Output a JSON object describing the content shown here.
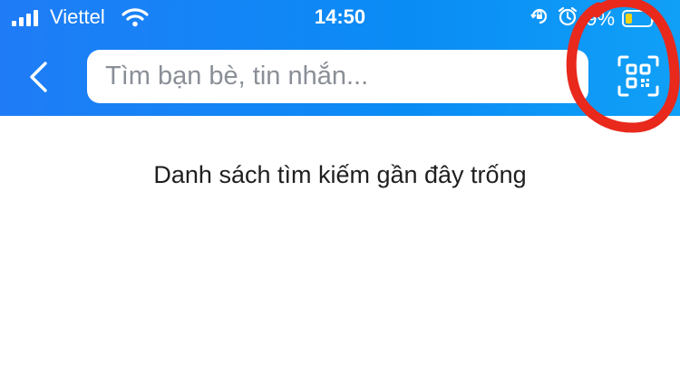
{
  "status_bar": {
    "carrier": "Viettel",
    "time": "14:50",
    "battery_percent": "9%",
    "icons": [
      "signal-icon",
      "wifi-icon",
      "rotation-lock-icon",
      "alarm-icon",
      "battery-icon"
    ],
    "battery_level": 0.09,
    "battery_color": "#ffd60a"
  },
  "header": {
    "background_color": "#1f7cf6",
    "back_icon": "chevron-left-icon",
    "qr_icon": "qr-scan-icon"
  },
  "search": {
    "placeholder": "Tìm bạn bè, tin nhắn...",
    "value": ""
  },
  "main": {
    "empty_message": "Danh sách tìm kiếm gần đây trống"
  },
  "annotation": {
    "shape": "hand-drawn-circle",
    "color": "#e8291c"
  }
}
